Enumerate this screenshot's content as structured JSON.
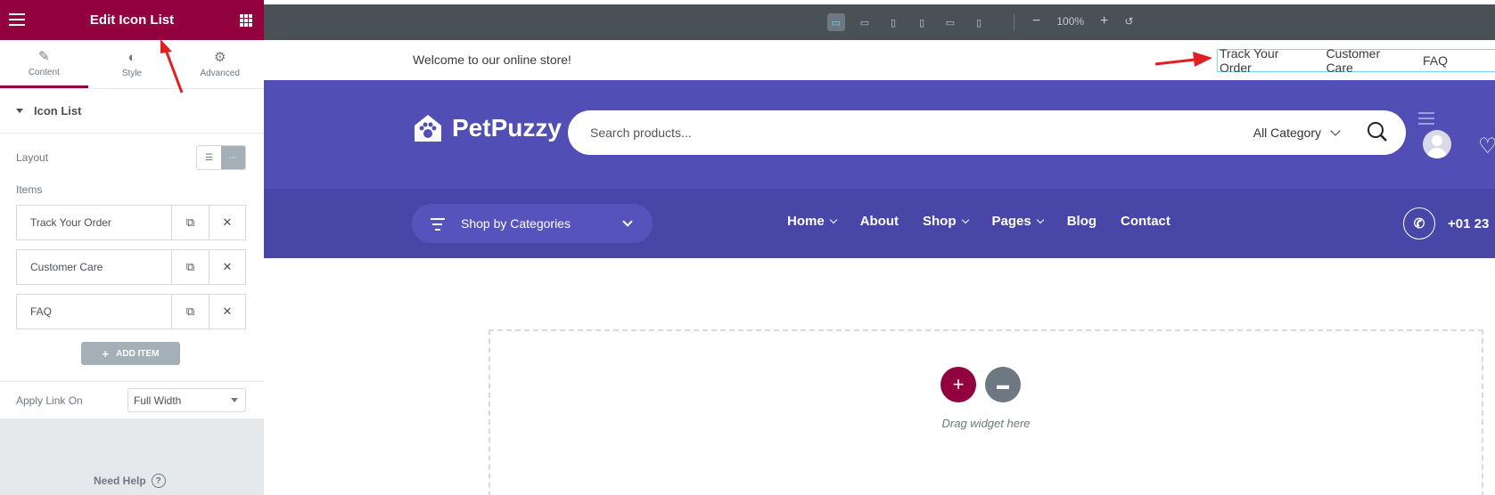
{
  "panel": {
    "title": "Edit Icon List",
    "tabs": [
      {
        "label": "Content",
        "icon": "pencil-icon"
      },
      {
        "label": "Style",
        "icon": "half-circle-icon"
      },
      {
        "label": "Advanced",
        "icon": "gear-icon"
      }
    ],
    "section_title": "Icon List",
    "layout_label": "Layout",
    "items_label": "Items",
    "items": [
      {
        "label": "Track Your Order"
      },
      {
        "label": "Customer Care"
      },
      {
        "label": "FAQ"
      }
    ],
    "add_item_label": "ADD ITEM",
    "apply_link_label": "Apply Link On",
    "apply_link_value": "Full Width",
    "help_label": "Need Help",
    "accent_color": "#93003f"
  },
  "toolbar": {
    "zoom": "100%"
  },
  "site": {
    "welcome": "Welcome to our online store!",
    "top_links": [
      "Track Your Order",
      "Customer Care",
      "FAQ"
    ],
    "logo": "PetPuzzy",
    "search_placeholder": "Search products...",
    "category": "All Category",
    "shop_by_categories": "Shop by Categories",
    "nav": [
      "Home",
      "About",
      "Shop",
      "Pages",
      "Blog",
      "Contact"
    ],
    "phone": "+01 23",
    "header_color": "#514fb5",
    "nav_color": "#4846a6"
  },
  "dropzone": {
    "text": "Drag widget here"
  }
}
